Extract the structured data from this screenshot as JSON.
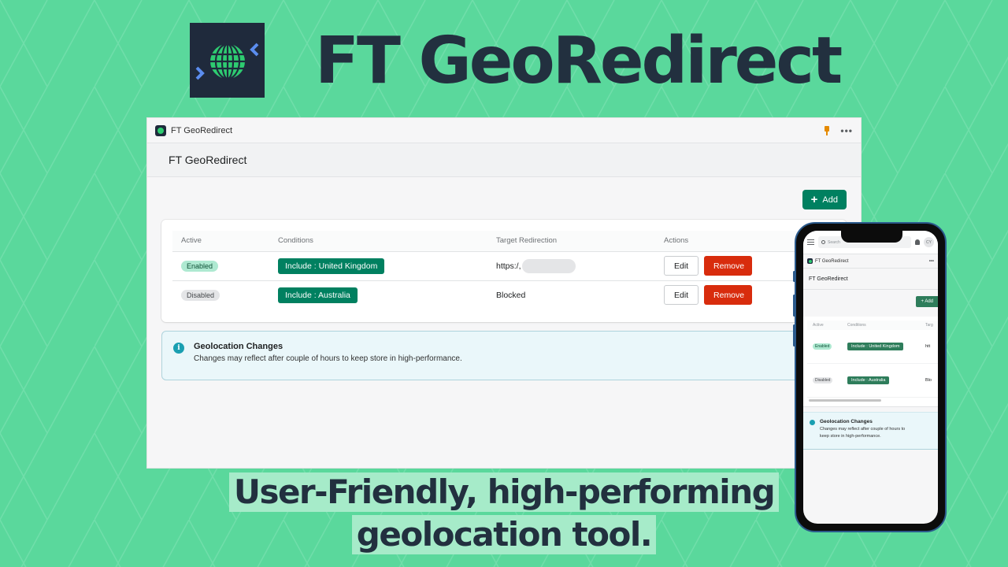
{
  "colors": {
    "background": "#5ad89c",
    "brand_dark": "#1f2a3c",
    "globe_green": "#2ecc71",
    "chevron_blue": "#5b8def",
    "primary": "#008060",
    "critical": "#d82c0d",
    "info": "#1a9fb1"
  },
  "hero": {
    "title": "FT GeoRedirect",
    "logo_icon": "globe-redirect-icon"
  },
  "window": {
    "topbar": {
      "app_name": "FT GeoRedirect",
      "icons": [
        "pin-icon",
        "more-icon"
      ],
      "more_label": "•••"
    },
    "page_title": "FT GeoRedirect",
    "add_button": {
      "icon": "+",
      "label": "Add"
    },
    "table": {
      "headers": [
        "Active",
        "Conditions",
        "Target Redirection",
        "Actions"
      ],
      "rows": [
        {
          "status": "Enabled",
          "condition": "Include : United Kingdom",
          "target": "https:/,",
          "edit": "Edit",
          "remove": "Remove"
        },
        {
          "status": "Disabled",
          "condition": "Include : Australia",
          "target": "Blocked",
          "edit": "Edit",
          "remove": "Remove"
        }
      ]
    },
    "banner": {
      "icon": "i",
      "title": "Geolocation Changes",
      "text": "Changes may reflect after couple of hours to keep store in high-performance."
    }
  },
  "phone": {
    "search_placeholder": "Search",
    "avatar_initials": "CY",
    "app_name": "FT GeoRedirect",
    "more_label": "•••",
    "page_title": "FT GeoRedirect",
    "add_label": "+ Add",
    "headers": [
      "Active",
      "Conditions",
      "Targ"
    ],
    "rows": [
      {
        "status": "Enabled",
        "condition": "Include : United Kingdom",
        "target": "htt"
      },
      {
        "status": "Disabled",
        "condition": "Include : Australia",
        "target": "Blo"
      }
    ],
    "banner": {
      "title": "Geolocation Changes",
      "text": "Changes may reflect after couple of hours to keep store in high-performance."
    }
  },
  "tagline": {
    "line1": "User-Friendly, high-performing",
    "line2": "geolocation tool."
  }
}
